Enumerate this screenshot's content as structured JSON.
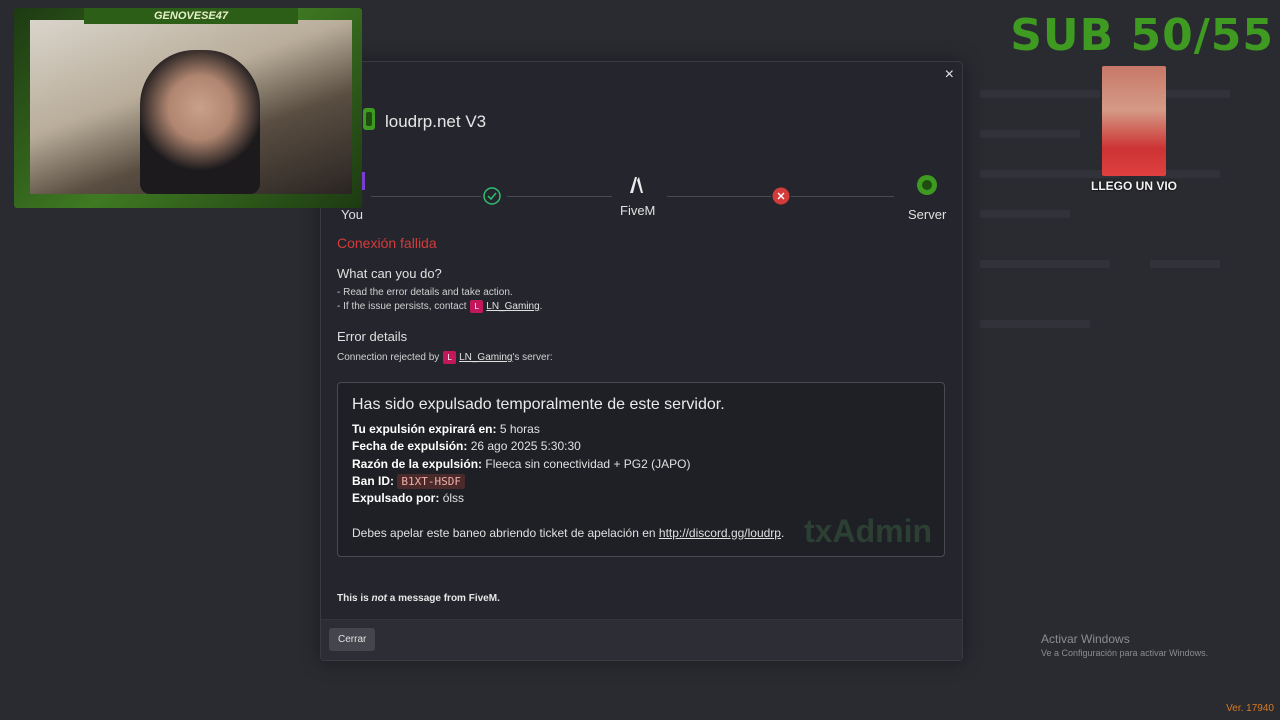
{
  "modal": {
    "server_name": "loudrp.net V3",
    "close_symbol": "×",
    "steps": {
      "you": "You",
      "fivem": "FiveM",
      "server": "Server"
    },
    "error_title": "Conexión fallida",
    "what_can_you_do": "What can you do?",
    "tip1": "- Read the error details and take action.",
    "tip2_prefix": "- If the issue persists, contact",
    "contact_badge": "L",
    "contact_name": "LN_Gaming",
    "tip2_suffix": ".",
    "error_details": "Error details",
    "rejected_prefix": "Connection rejected by",
    "rejected_badge": "L",
    "rejected_name": "LN_Gaming",
    "rejected_suffix": "'s server:",
    "ban": {
      "headline": "Has sido expulsado temporalmente de este servidor.",
      "expires_label": "Tu expulsión expirará en:",
      "expires_value": "5 horas",
      "date_label": "Fecha de expulsión:",
      "date_value": "26 ago 2025 5:30:30",
      "reason_label": "Razón de la expulsión:",
      "reason_value": "Fleeca sin conectividad + PG2 (JAPO)",
      "banid_label": "Ban ID:",
      "banid_value": "B1XT-HSDF",
      "by_label": "Expulsado por:",
      "by_value": "ólss",
      "appeal_text": "Debes apelar este baneo abriendo ticket de apelación en",
      "appeal_link": "http://discord.gg/loudrp",
      "appeal_end": ".",
      "watermark": "txAdmin"
    },
    "not_message_pre": "This is",
    "not_message_em": "not",
    "not_message_post": "a message from FiveM.",
    "close_button": "Cerrar"
  },
  "stream_overlay": {
    "streamer_name": "GENOVESE47",
    "sub_counter": "SUB 50/55",
    "video_caption": "LLEGO UN VIO"
  },
  "windows_activation": {
    "title": "Activar Windows",
    "subtitle": "Ve a Configuración para activar Windows."
  },
  "version": "Ver. 17940",
  "colors": {
    "error_red": "#d33b3b",
    "accent_green": "#3f9a21",
    "success_green": "#2fbf71",
    "version_orange": "#d9791f"
  }
}
